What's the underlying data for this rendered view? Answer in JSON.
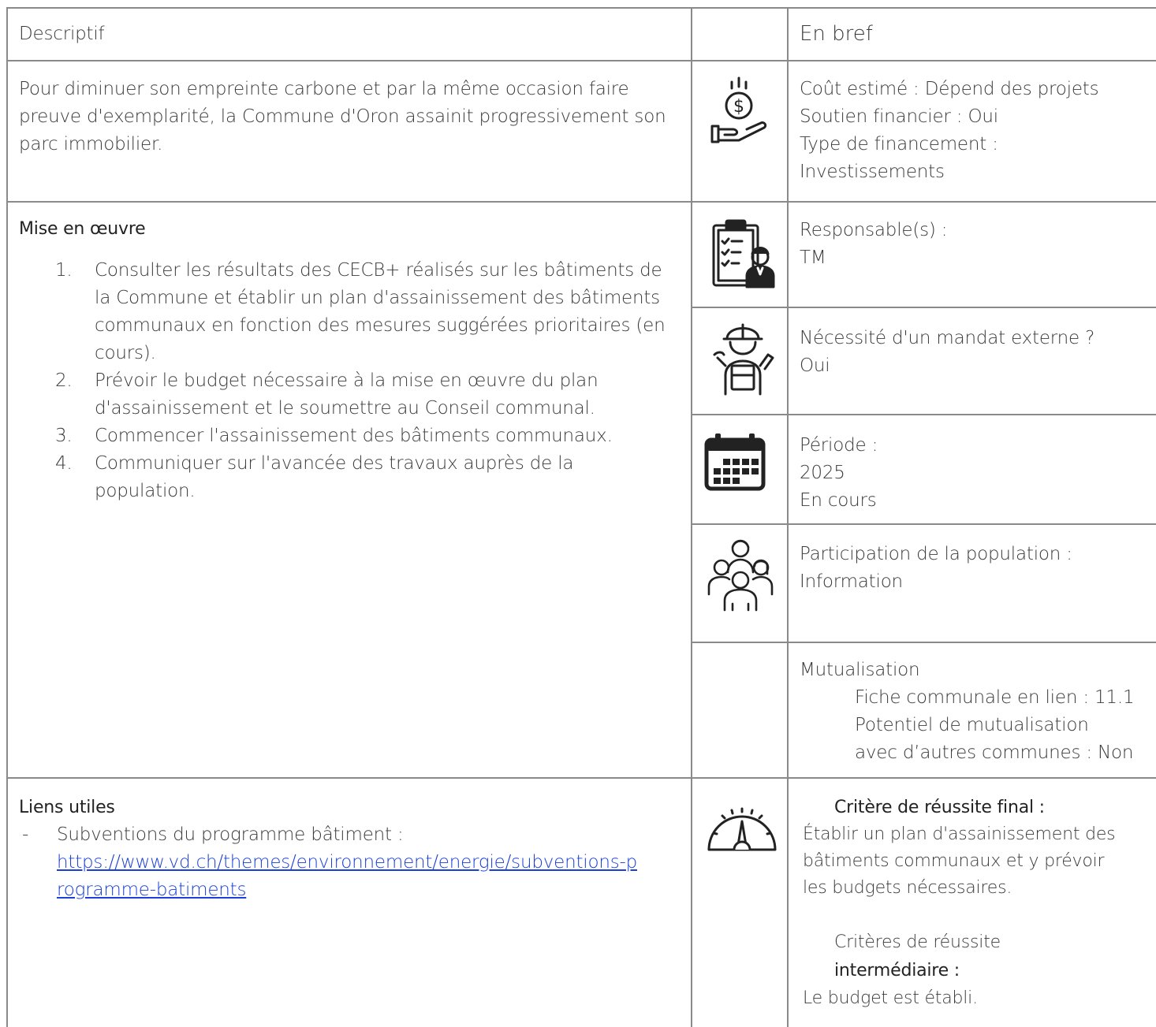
{
  "headers": {
    "left": "Descriptif",
    "right": "En bref"
  },
  "descriptif": {
    "text": "Pour diminuer son empreinte carbone et  par la même occasion faire preuve d'exemplarité, la Commune d'Oron assainit progressivement son parc immobilier."
  },
  "cost": {
    "line1": "Coût estimé : Dépend des projets",
    "line2": "Soutien financier : Oui",
    "line3": "Type de financement :",
    "line4": "Investissements"
  },
  "mise_en_oeuvre": {
    "title": "Mise en œuvre",
    "steps": [
      {
        "num": "1.",
        "text": "Consulter les résultats des CECB+ réalisés sur les bâtiments de la Commune et établir un plan d'assainissement des bâtiments communaux en fonction des mesures suggérées prioritaires (en cours)."
      },
      {
        "num": "2.",
        "text": "Prévoir le budget nécessaire à la mise en œuvre du plan d'assainissement et le soumettre au Conseil communal."
      },
      {
        "num": "3.",
        "text": "Commencer l'assainissement des bâtiments communaux."
      },
      {
        "num": "4.",
        "text": "Communiquer sur l'avancée des travaux auprès de la population."
      }
    ]
  },
  "responsable": {
    "label": "Responsable(s) :",
    "value": "TM"
  },
  "mandat": {
    "label": "Nécessité d'un mandat externe ?",
    "value": "Oui"
  },
  "periode": {
    "label": "Période :",
    "year": "2025",
    "status": "En cours"
  },
  "participation": {
    "label": "Participation de la population :",
    "value": "Information"
  },
  "mutualisation": {
    "title": "Mutualisation",
    "fiche": "Fiche communale en lien : 11.1",
    "potentiel1": "Potentiel de mutualisation",
    "potentiel2": "avec d’autres communes : Non"
  },
  "liens": {
    "title": "Liens utiles",
    "dash": "-",
    "item_label": "Subventions du programme bâtiment :",
    "url_line1": "https://www.vd.ch/themes/environnement/energie/subventions-p",
    "url_line2": "rogramme-batiments"
  },
  "criteres": {
    "final_title": "Critère de réussite final :",
    "final_text1": "Établir un plan d'assainissement des",
    "final_text2": "bâtiments communaux et y prévoir",
    "final_text3": "les budgets nécessaires.",
    "inter_title1": "Critères de réussite",
    "inter_title2": "intermédiaire :",
    "inter_text": "Le budget est établi."
  },
  "icons": {
    "cost": "money-hand-icon",
    "responsable": "clipboard-manager-icon",
    "mandat": "worker-icon",
    "periode": "calendar-icon",
    "participation": "group-people-icon",
    "criteres": "gauge-icon"
  }
}
